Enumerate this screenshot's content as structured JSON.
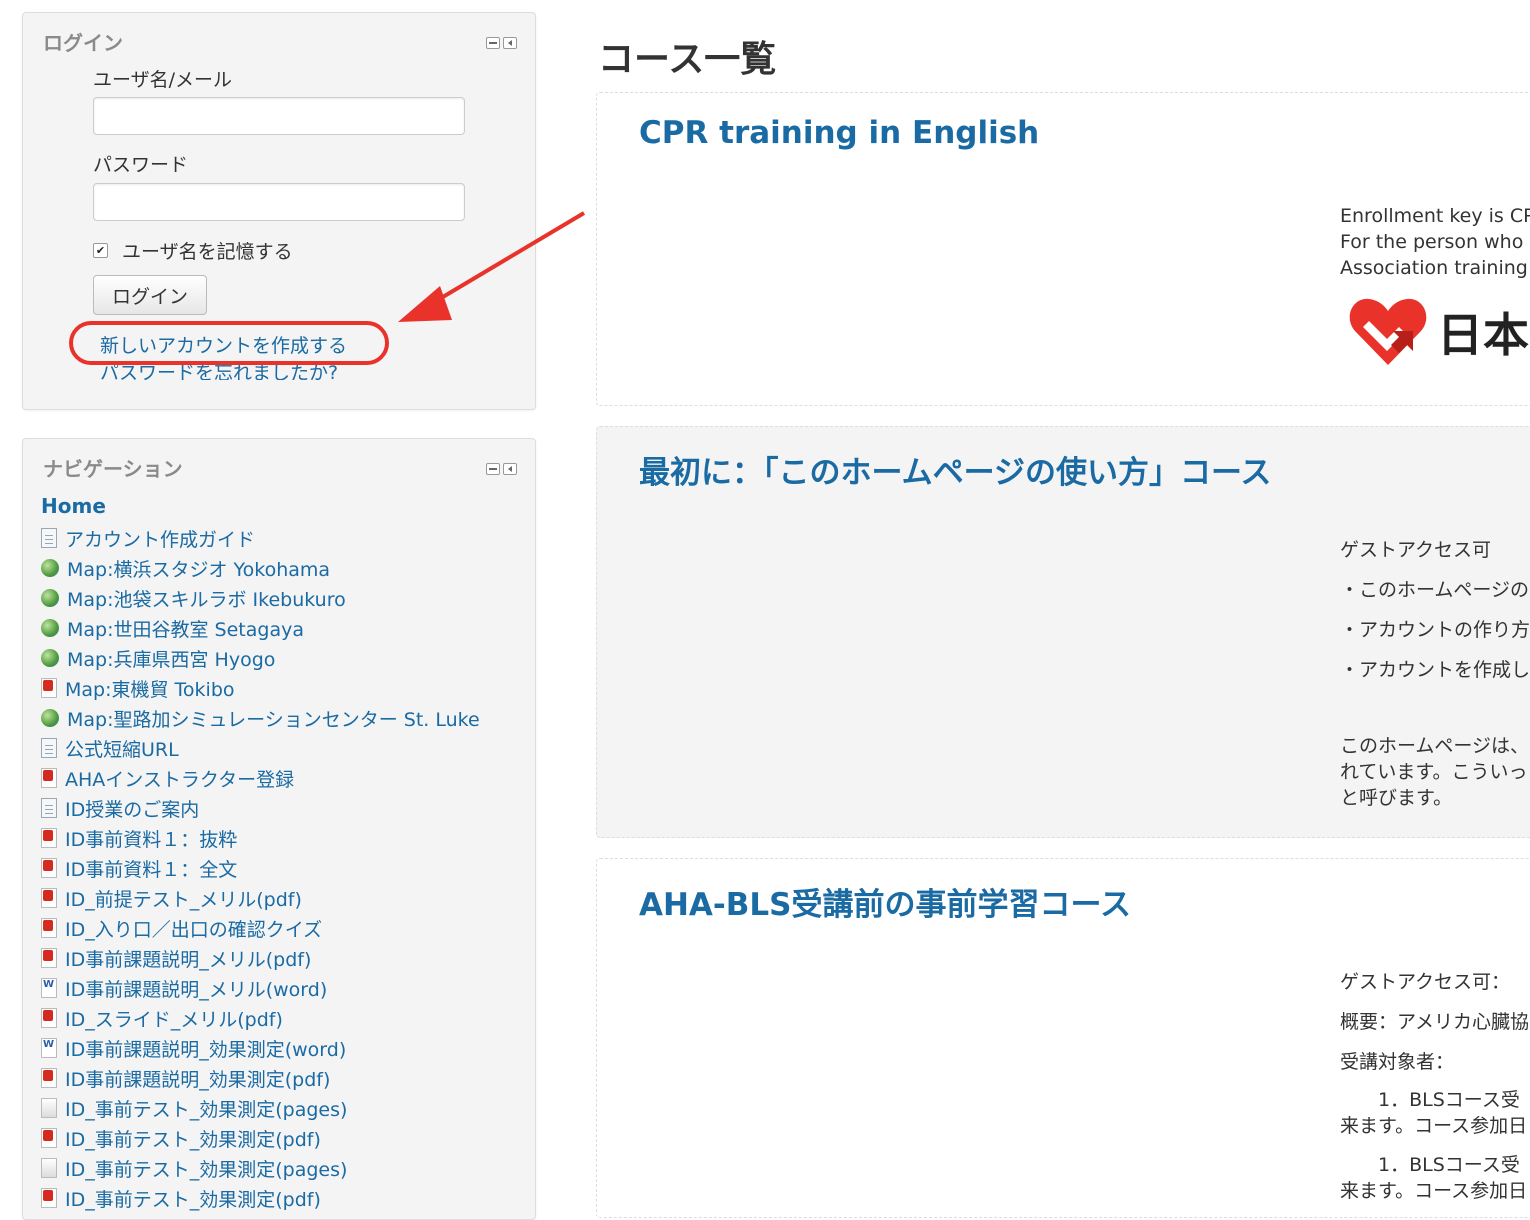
{
  "login": {
    "title": "ログイン",
    "username_label": "ユーザ名/メール",
    "password_label": "パスワード",
    "remember_label": "ユーザ名を記憶する",
    "remember_checked": true,
    "login_button": "ログイン",
    "create_account": "新しいアカウントを作成する",
    "forgot_password": "パスワードを忘れましたか?"
  },
  "navigation": {
    "title": "ナビゲーション",
    "home": "Home",
    "items": [
      {
        "label": "アカウント作成ガイド",
        "icon": "page-icon"
      },
      {
        "label": "Map:横浜スタジオ Yokohama",
        "icon": "url-icon"
      },
      {
        "label": "Map:池袋スキルラボ Ikebukuro",
        "icon": "url-icon"
      },
      {
        "label": "Map:世田谷教室 Setagaya",
        "icon": "url-icon"
      },
      {
        "label": "Map:兵庫県西宮 Hyogo",
        "icon": "url-icon"
      },
      {
        "label": "Map:東機貿 Tokibo",
        "icon": "pdf-icon"
      },
      {
        "label": "Map:聖路加シミュレーションセンター St. Luke",
        "icon": "url-icon"
      },
      {
        "label": "公式短縮URL",
        "icon": "page-icon"
      },
      {
        "label": "AHAインストラクター登録",
        "icon": "pdf-icon"
      },
      {
        "label": "ID授業のご案内",
        "icon": "page-icon"
      },
      {
        "label": "ID事前資料１：抜粋",
        "icon": "pdf-icon"
      },
      {
        "label": "ID事前資料１：全文",
        "icon": "pdf-icon"
      },
      {
        "label": "ID_前提テスト_メリル(pdf)",
        "icon": "pdf-icon"
      },
      {
        "label": "ID_入り口／出口の確認クイズ",
        "icon": "pdf-icon"
      },
      {
        "label": "ID事前課題説明_メリル(pdf)",
        "icon": "pdf-icon"
      },
      {
        "label": "ID事前課題説明_メリル(word)",
        "icon": "word-icon"
      },
      {
        "label": "ID_スライド_メリル(pdf)",
        "icon": "pdf-icon"
      },
      {
        "label": "ID事前課題説明_効果測定(word)",
        "icon": "word-icon"
      },
      {
        "label": "ID事前課題説明_効果測定(pdf)",
        "icon": "pdf-icon"
      },
      {
        "label": "ID_事前テスト_効果測定(pages)",
        "icon": "pages-icon"
      },
      {
        "label": "ID_事前テスト_効果測定(pdf)",
        "icon": "pdf-icon"
      },
      {
        "label": "ID_事前テスト_効果測定(pages)",
        "icon": "pages-icon"
      },
      {
        "label": "ID_事前テスト_効果測定(pdf)",
        "icon": "pdf-icon"
      }
    ]
  },
  "main": {
    "heading": "コース一覧",
    "courses": [
      {
        "title": "CPR training in English",
        "summary": [
          "Enrollment key is   CP",
          "For the person who w",
          "Association training p"
        ],
        "logo_text": "日本"
      },
      {
        "title": "最初に：「このホームページの使い方」コース",
        "summary": [
          "ゲストアクセス可",
          "・このホームページの",
          "・アカウントの作り方",
          "・アカウントを作成し",
          "このホームページは、",
          "れています。こういっ",
          "と呼びます。"
        ]
      },
      {
        "title": "AHA-BLS受講前の事前学習コース",
        "summary": [
          "ゲストアクセス可：",
          "概要：アメリカ心臓協",
          "受講対象者：",
          "　　1．BLSコース受",
          "来ます。コース参加日",
          "　　1．BLSコース受",
          "来ます。コース参加日"
        ]
      }
    ]
  },
  "colors": {
    "link": "#1a6aa3",
    "annotation": "#e8322a",
    "block_bg": "#f4f4f4"
  }
}
